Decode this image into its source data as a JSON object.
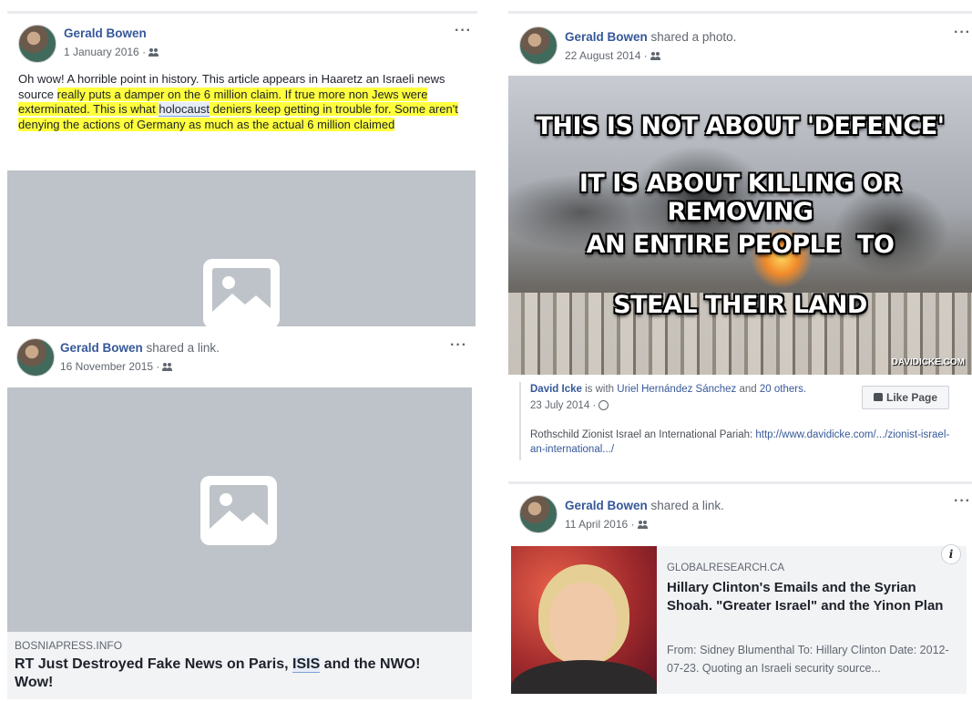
{
  "post1": {
    "author": "Gerald Bowen",
    "date": "1 January 2016 ·",
    "text_part1": "Oh wow! A horrible point in history. This article appears in Haaretz an Israeli news source ",
    "text_hl1": "really puts a damper on the 6 million claim. If true more non Jews were exterminated. This is what ",
    "text_link": "holocaust",
    "text_hl2": " deniers keep getting in trouble for. Some aren't denying the actions of Germany as much as the actual 6 million claimed"
  },
  "post2": {
    "author": "Gerald Bowen",
    "action": "shared a link.",
    "date": "16 November 2015 ·",
    "source": "BOSNIAPRESS.INFO",
    "title_part1": "RT Just Destroyed Fake News on Paris, ",
    "title_link": "ISIS",
    "title_part2": " and the NWO! Wow!"
  },
  "post3": {
    "author": "Gerald Bowen",
    "action": "shared a photo.",
    "date": "22 August 2014 ·",
    "meme_lines": [
      "THIS IS NOT ABOUT 'DEFENCE'",
      "IT IS ABOUT KILLING OR REMOVING",
      "AN ENTIRE PEOPLE  TO",
      "STEAL THEIR LAND"
    ],
    "watermark": "DAVIDICKE.COM",
    "shared_author": "David Icke",
    "shared_with": "is with",
    "shared_tagged": "Uriel Hernández Sánchez",
    "shared_and": "and",
    "shared_others": "20 others.",
    "shared_date": "23 July 2014 ·",
    "like_page": "Like Page",
    "shared_text": "Rothschild Zionist Israel an International Pariah: ",
    "shared_url": "http://www.davidicke.com/.../zionist-israel-an-international.../"
  },
  "post4": {
    "author": "Gerald Bowen",
    "action": "shared a link.",
    "date": "11 April 2016 ·",
    "source": "GLOBALRESEARCH.CA",
    "title": "Hillary Clinton's Emails and the Syrian Shoah. \"Greater Israel\" and the Yinon Plan",
    "desc": "From: Sidney Blumenthal To: Hillary Clinton Date: 2012-07-23. Quoting an Israeli security source...",
    "info": "i"
  },
  "menu_glyph": "···"
}
